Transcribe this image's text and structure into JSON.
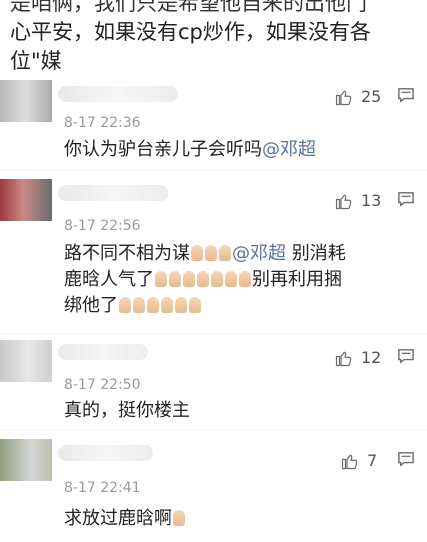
{
  "top_text": {
    "line1": "是咱俩，我们只是希望他自来的出他门",
    "line2": "心平安，如果没有cp炒作，如果没有各",
    "line3": "位\"媒"
  },
  "comments": [
    {
      "time": "8-17 22:36",
      "likes": "25",
      "text": "你认为驴台亲儿子会听吗",
      "mention": "@邓超",
      "like_icon": "thumbs-up-icon",
      "reply_icon": "comment-bubble-icon"
    },
    {
      "time": "8-17 22:56",
      "likes": "13",
      "line1_a": "路不同不相为谋",
      "line1_mention": "@邓超",
      "line1_b": " 别消耗",
      "line2_a": "鹿晗人气了",
      "line2_b": "别再利用捆",
      "line3_a": "绑他了",
      "like_icon": "thumbs-up-icon",
      "reply_icon": "comment-bubble-icon",
      "emoji_icon": "folded-hands-emoji"
    },
    {
      "time": "8-17 22:50",
      "likes": "12",
      "text": "真的，挺你楼主",
      "like_icon": "thumbs-up-icon",
      "reply_icon": "comment-bubble-icon"
    },
    {
      "time": "8-17 22:41",
      "likes": "7",
      "text": "求放过鹿晗啊",
      "like_icon": "thumbs-up-icon",
      "reply_icon": "comment-bubble-icon",
      "emoji_icon": "folded-hands-emoji"
    }
  ]
}
